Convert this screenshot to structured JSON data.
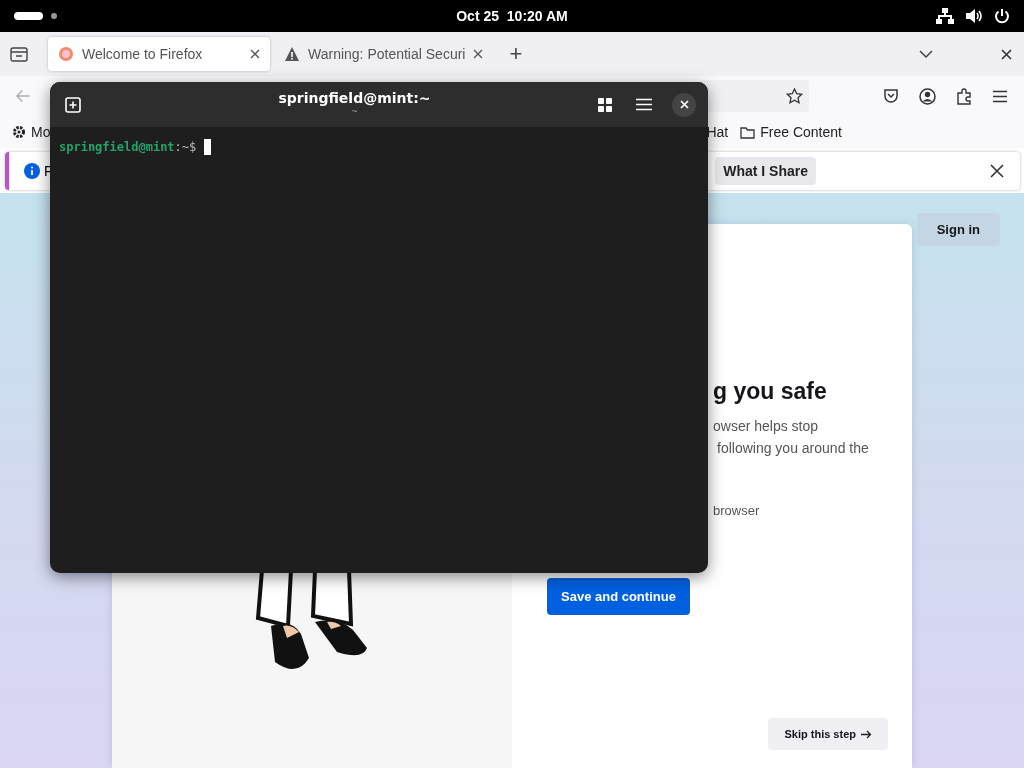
{
  "top_bar": {
    "clock": "Oct 25  10:20 AM"
  },
  "browser": {
    "tabs": [
      {
        "title": "Welcome to Firefox",
        "selected": true,
        "kind": "firefox"
      },
      {
        "title": "Warning: Potential Securi",
        "selected": false,
        "kind": "warning"
      }
    ],
    "new_tab": "+",
    "bookmarks": [
      {
        "label": "Mo",
        "kind": "gear"
      },
      {
        "label": "Hat",
        "kind": "plain"
      },
      {
        "label": "Free Content",
        "kind": "folder"
      }
    ],
    "notification": {
      "message": "F",
      "button": "What I Share"
    },
    "page": {
      "sign_in": "Sign in",
      "heading": "g you safe",
      "body_lines": [
        "owser helps stop",
        "following you around the"
      ],
      "option": "browser",
      "primary": "Save and continue",
      "skip": "Skip this step"
    }
  },
  "terminal": {
    "title": "springfield@mint:~",
    "subtitle": "~",
    "prompt_user": "springfield@mint",
    "prompt_path": ":~$"
  }
}
